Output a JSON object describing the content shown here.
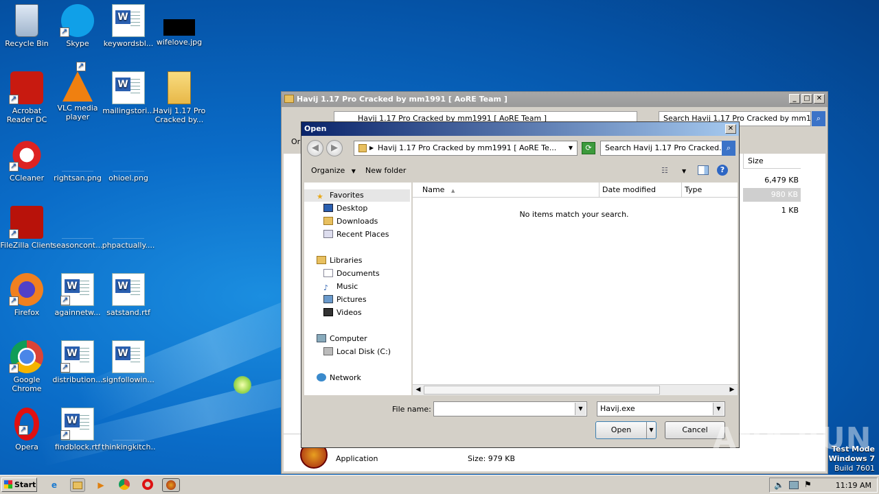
{
  "desktop": {
    "icons": [
      {
        "label": "Recycle Bin",
        "icon": "recycle-bin-icon"
      },
      {
        "label": "Skype",
        "icon": "skype-icon"
      },
      {
        "label": "keywordsbl...",
        "icon": "word-doc-icon"
      },
      {
        "label": "wifelove.jpg",
        "icon": "image-icon"
      },
      {
        "label": "Acrobat Reader DC",
        "icon": "acrobat-icon"
      },
      {
        "label": "VLC media player",
        "icon": "vlc-icon"
      },
      {
        "label": "mailingstori...",
        "icon": "word-doc-icon"
      },
      {
        "label": "Havij 1.17 Pro Cracked by...",
        "icon": "folder-icon"
      },
      {
        "label": "CCleaner",
        "icon": "ccleaner-icon"
      },
      {
        "label": "rightsan.png",
        "icon": "image-icon"
      },
      {
        "label": "ohioel.png",
        "icon": "image-icon"
      },
      {
        "label": "FileZilla Client",
        "icon": "filezilla-icon"
      },
      {
        "label": "seasoncont...",
        "icon": "image-icon"
      },
      {
        "label": "phpactually....",
        "icon": "image-icon"
      },
      {
        "label": "Firefox",
        "icon": "firefox-icon"
      },
      {
        "label": "againnetw...",
        "icon": "word-doc-icon"
      },
      {
        "label": "satstand.rtf",
        "icon": "word-doc-icon"
      },
      {
        "label": "Google Chrome",
        "icon": "chrome-icon"
      },
      {
        "label": "distribution...",
        "icon": "word-doc-icon"
      },
      {
        "label": "signfollowin...",
        "icon": "word-doc-icon"
      },
      {
        "label": "Opera",
        "icon": "opera-icon"
      },
      {
        "label": "findblock.rtf",
        "icon": "word-doc-icon"
      },
      {
        "label": "thinkingkitch...",
        "icon": "image-icon"
      }
    ]
  },
  "bg_window": {
    "title": "Havij 1.17 Pro Cracked by mm1991 [ AoRE Team ]",
    "address": "Havij 1.17 Pro Cracked by mm1991 [ AoRE Team ]",
    "search": "Search Havij 1.17 Pro Cracked by mm1...",
    "org_stub": "Or",
    "col_size": "Size",
    "sizes": [
      "6,479 KB",
      "980 KB",
      "1 KB"
    ],
    "status_type": "Application",
    "status_size": "Size: 979 KB"
  },
  "dialog": {
    "title": "Open",
    "path": "Havij 1.17 Pro Cracked by mm1991 [ AoRE Te...",
    "search_placeholder": "Search Havij 1.17 Pro Cracked...",
    "organize": "Organize",
    "new_folder": "New folder",
    "nav": {
      "favorites": "Favorites",
      "desktop": "Desktop",
      "downloads": "Downloads",
      "recent": "Recent Places",
      "libraries": "Libraries",
      "documents": "Documents",
      "music": "Music",
      "pictures": "Pictures",
      "videos": "Videos",
      "computer": "Computer",
      "local_disk": "Local Disk (C:)",
      "network": "Network"
    },
    "columns": {
      "name": "Name",
      "date": "Date modified",
      "type": "Type"
    },
    "empty_message": "No items match your search.",
    "filename_label": "File name:",
    "filename_value": "",
    "filter_value": "Havij.exe",
    "open_label": "Open",
    "cancel_label": "Cancel"
  },
  "taskbar": {
    "start": "Start",
    "clock": "11:19 AM"
  },
  "overlay": {
    "watermark": "ANY RUN",
    "test_mode": "Test Mode",
    "os": "Windows 7",
    "build": "Build 7601"
  }
}
